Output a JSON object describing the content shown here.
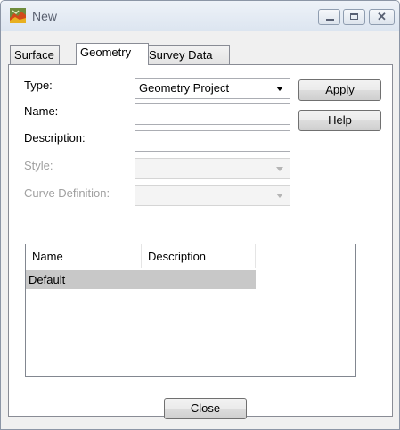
{
  "window": {
    "title": "New",
    "controls": {
      "minimize": "minimize",
      "maximize": "maximize",
      "close": "✕"
    }
  },
  "tabs": [
    {
      "label": "Surface",
      "active": false
    },
    {
      "label": "Geometry",
      "active": true
    },
    {
      "label": "Survey Data",
      "active": false
    }
  ],
  "form": {
    "type_label": "Type:",
    "type_value": "Geometry Project",
    "name_label": "Name:",
    "name_value": "",
    "description_label": "Description:",
    "description_value": "",
    "style_label": "Style:",
    "style_value": "",
    "curve_label": "Curve Definition:",
    "curve_value": ""
  },
  "buttons": {
    "apply": "Apply",
    "help": "Help",
    "close": "Close"
  },
  "list": {
    "columns": [
      "Name",
      "Description",
      ""
    ],
    "rows": [
      {
        "name": "Default",
        "description": "",
        "selected": true
      }
    ]
  },
  "colors": {
    "selection": "#c8c8c8",
    "disabled_text": "#a0a0a0",
    "title_text": "#5a6170"
  }
}
